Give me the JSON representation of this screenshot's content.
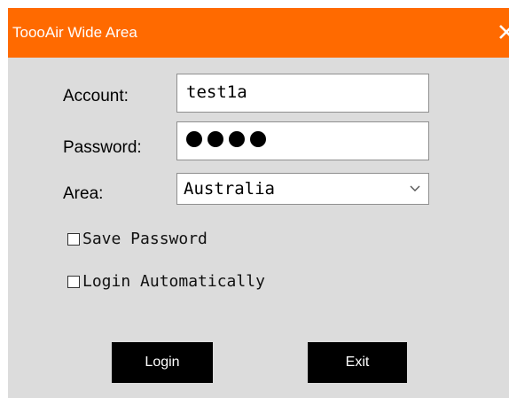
{
  "window": {
    "title": "ToooAir Wide Area",
    "close_glyph": "×",
    "accent_color": "#ff6a00"
  },
  "form": {
    "account_label": "Account:",
    "account_value": "test1a",
    "password_label": "Password:",
    "password_masked_length": 4,
    "area_label": "Area:",
    "area_value": "Australia",
    "save_password_label": "Save Password",
    "save_password_checked": false,
    "login_auto_label": "Login Automatically",
    "login_auto_checked": false
  },
  "buttons": {
    "login_label": "Login",
    "exit_label": "Exit"
  }
}
